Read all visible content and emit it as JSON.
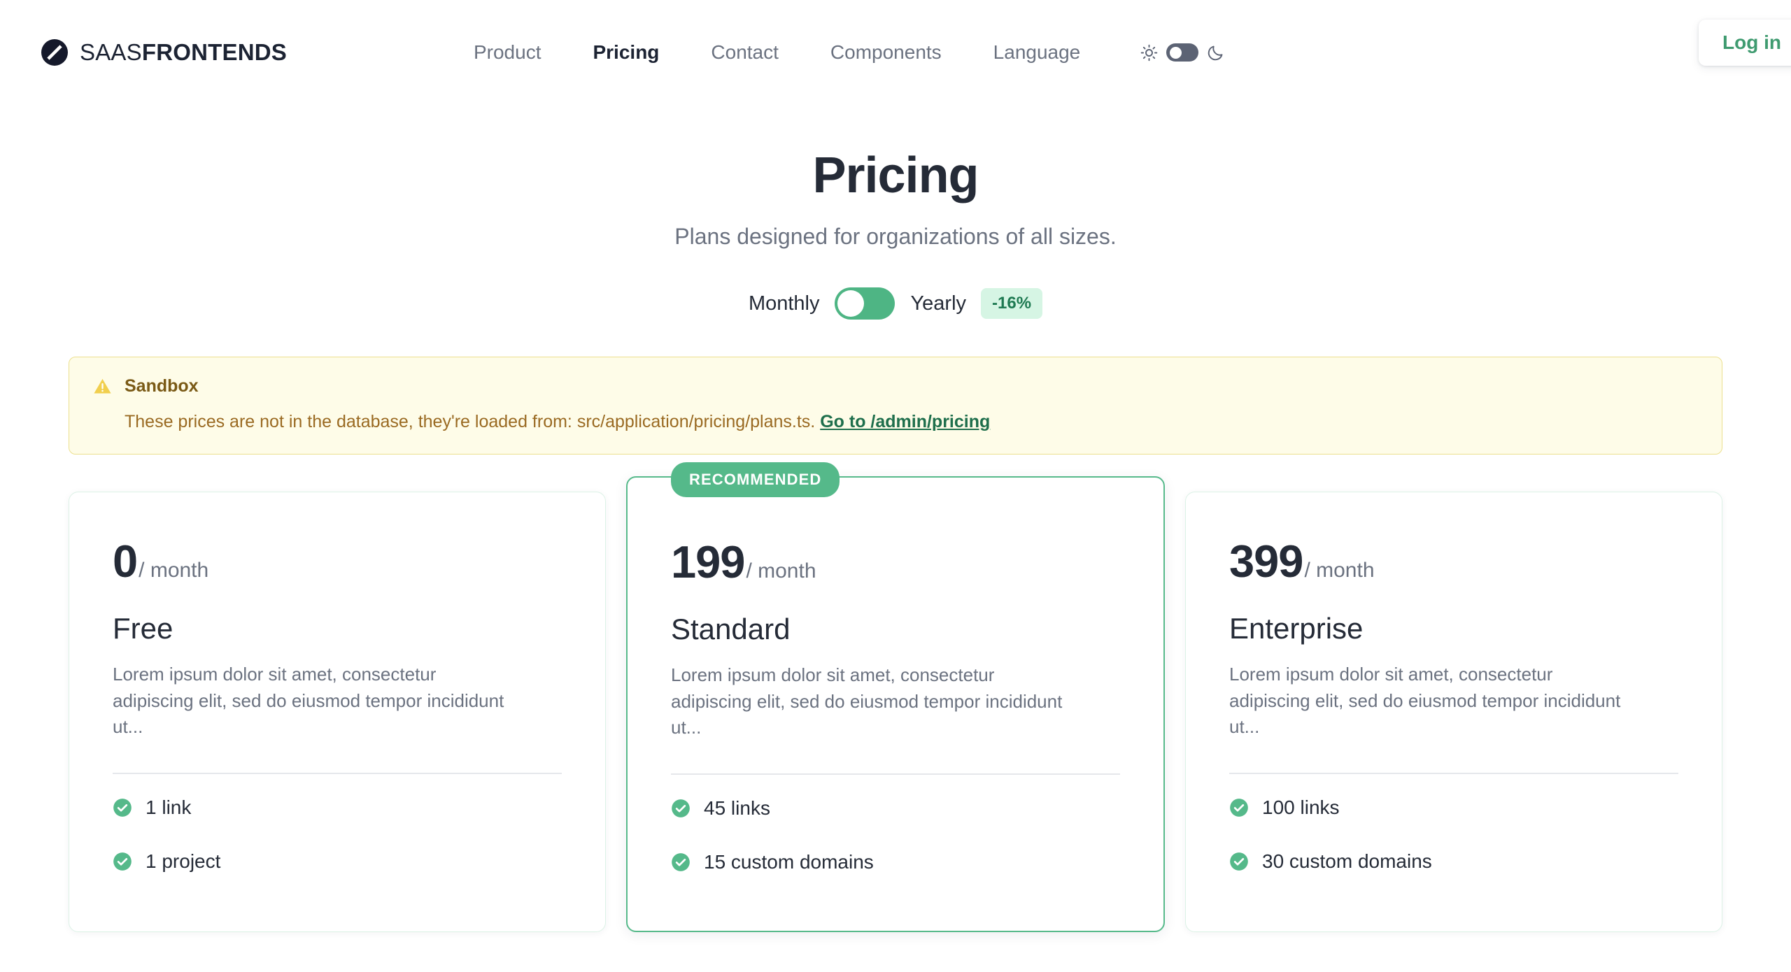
{
  "header": {
    "brand": {
      "light": "SAAS",
      "bold": "FRONTENDS",
      "logo_icon": "slashed-circle-logo-icon"
    },
    "nav": [
      {
        "label": "Product",
        "active": false
      },
      {
        "label": "Pricing",
        "active": true
      },
      {
        "label": "Contact",
        "active": false
      },
      {
        "label": "Components",
        "active": false
      },
      {
        "label": "Language",
        "active": false
      }
    ],
    "theme": {
      "light_icon": "sun-icon",
      "dark_icon": "moon-icon",
      "toggle_state": "light",
      "toggle_color": "#5c6374"
    },
    "login_label": "Log in",
    "login_color": "#3f9b70"
  },
  "hero": {
    "title": "Pricing",
    "subtitle": "Plans designed for organizations of all sizes."
  },
  "billing": {
    "monthly_label": "Monthly",
    "yearly_label": "Yearly",
    "discount_badge": "-16%",
    "selected": "Monthly",
    "toggle_color": "#4eb584",
    "badge_bg": "#d6f5e4",
    "badge_color": "#1f7a52"
  },
  "alert": {
    "icon": "warning-triangle-icon",
    "title": "Sandbox",
    "body": "These prices are not in the database, they're loaded from: src/application/pricing/plans.ts.",
    "link_label": "Go to /admin/pricing",
    "bg": "#fefce8",
    "border": "#ece08e",
    "title_color": "#7a5a16",
    "body_color": "#9a6a22",
    "link_color": "#1f6f4c"
  },
  "plans": [
    {
      "price": "0",
      "period": "/ month",
      "name": "Free",
      "description": "Lorem ipsum dolor sit amet, consectetur adipiscing elit, sed do eiusmod tempor incididunt ut...",
      "featured": false,
      "badge": "",
      "features": [
        {
          "icon": "check-circle-icon",
          "label": "1 link"
        },
        {
          "icon": "check-circle-icon",
          "label": "1 project"
        }
      ]
    },
    {
      "price": "199",
      "period": "/ month",
      "name": "Standard",
      "description": "Lorem ipsum dolor sit amet, consectetur adipiscing elit, sed do eiusmod tempor incididunt ut...",
      "featured": true,
      "badge": "RECOMMENDED",
      "features": [
        {
          "icon": "check-circle-icon",
          "label": "45 links"
        },
        {
          "icon": "check-circle-icon",
          "label": "15 custom domains"
        }
      ]
    },
    {
      "price": "399",
      "period": "/ month",
      "name": "Enterprise",
      "description": "Lorem ipsum dolor sit amet, consectetur adipiscing elit, sed do eiusmod tempor incididunt ut...",
      "featured": false,
      "badge": "",
      "features": [
        {
          "icon": "check-circle-icon",
          "label": "100 links"
        },
        {
          "icon": "check-circle-icon",
          "label": "30 custom domains"
        }
      ]
    }
  ],
  "colors": {
    "accent_green": "#4eb584",
    "accent_green_dark": "#3f9b70",
    "text_dark": "#252b37",
    "text_muted": "#6b7280",
    "card_border": "#dcf2e6",
    "featured_border": "#57ba8b"
  }
}
